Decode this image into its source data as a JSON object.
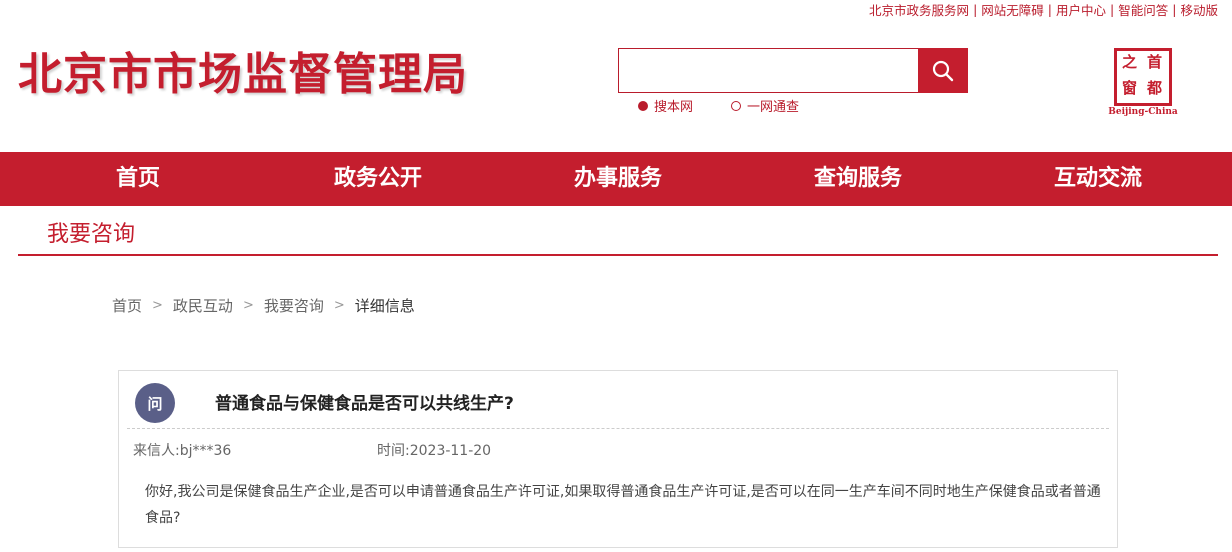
{
  "top_links": [
    "北京市政务服务网",
    "网站无障碍",
    "用户中心",
    "智能问答",
    "移动版"
  ],
  "header": {
    "site_title": "北京市市场监督管理局",
    "search_placeholder": "",
    "search_scope_options": [
      {
        "label": "搜本网",
        "selected": true
      },
      {
        "label": "一网通查",
        "selected": false
      }
    ],
    "logo": {
      "chars": [
        "首",
        "都",
        "之",
        "窗"
      ],
      "caption": "Beijing-China"
    }
  },
  "nav": [
    "首页",
    "政务公开",
    "办事服务",
    "查询服务",
    "互动交流"
  ],
  "section_title": "我要咨询",
  "breadcrumb": [
    "首页",
    "政民互动",
    "我要咨询",
    "详细信息"
  ],
  "question": {
    "badge": "问",
    "title": "普通食品与保健食品是否可以共线生产?",
    "sender_label": "来信人:",
    "sender": "bj***36",
    "time_label": "时间:",
    "time": "2023-11-20",
    "body": "你好,我公司是保健食品生产企业,是否可以申请普通食品生产许可证,如果取得普通食品生产许可证,是否可以在同一生产车间不同时地生产保健食品或者普通食品?"
  },
  "colors": {
    "brand_red": "#c41e2e",
    "badge_purple": "#5a5f88"
  }
}
